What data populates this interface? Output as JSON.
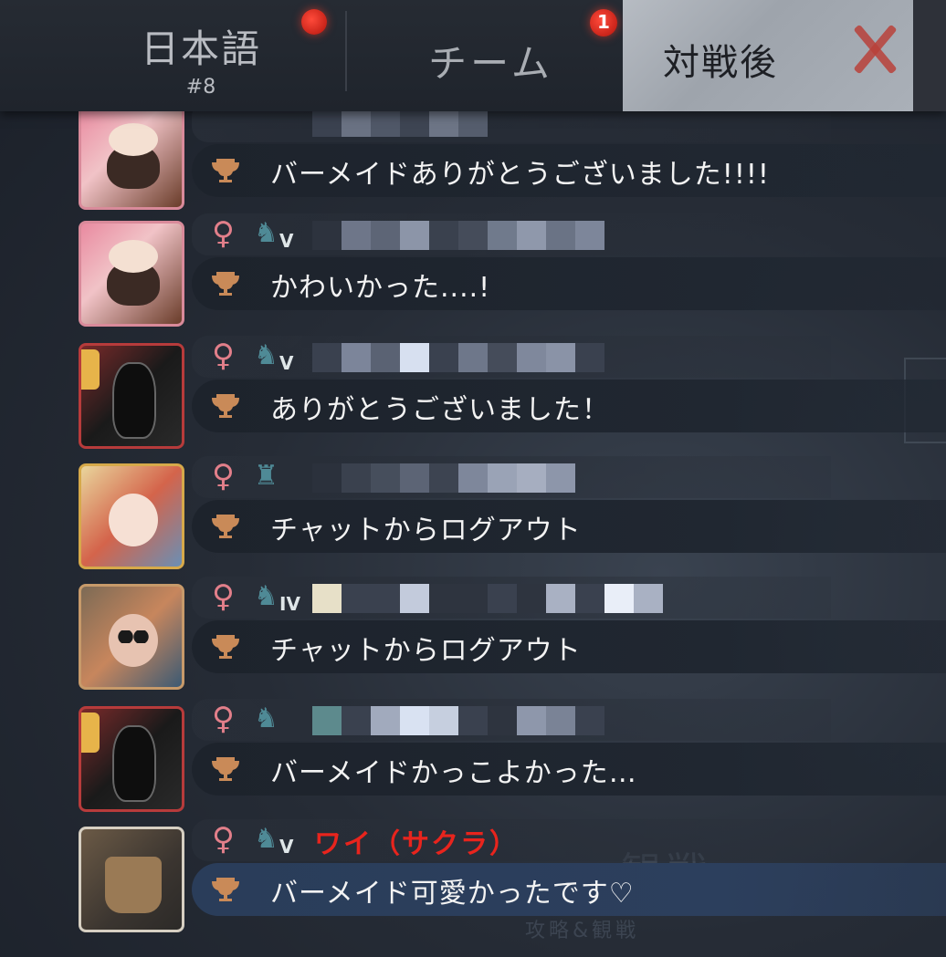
{
  "tabs": {
    "language": {
      "label": "日本語",
      "sub": "#8"
    },
    "team": {
      "label": "チーム",
      "badge": "1"
    },
    "after_match": {
      "label": "対戦後"
    }
  },
  "background": {
    "text_large": "観戦",
    "text_small": "攻略&観戦"
  },
  "messages": [
    {
      "avatar": "bartender",
      "gender": "",
      "rank": "",
      "name": "",
      "text": "バーメイドありがとうございました!!!!"
    },
    {
      "avatar": "bartender",
      "gender": "♀",
      "rank": "V",
      "name": "",
      "text": "かわいかった....!"
    },
    {
      "avatar": "dark",
      "gender": "♀",
      "rank": "V",
      "name": "",
      "text": "ありがとうございました！"
    },
    {
      "avatar": "girl",
      "gender": "♀",
      "rank": "",
      "name": "",
      "text": "チャットからログアウト"
    },
    {
      "avatar": "doll",
      "gender": "♀",
      "rank": "IV",
      "name": "",
      "text": "チャットからログアウト"
    },
    {
      "avatar": "dark",
      "gender": "♀",
      "rank": "",
      "name": "",
      "text": "バーメイドかっこよかった…"
    },
    {
      "avatar": "scarecrow",
      "gender": "♀",
      "rank": "V",
      "name": "ワイ（サクラ）",
      "text": "バーメイド可愛かったです♡",
      "is_self": true
    }
  ],
  "colors": {
    "accent_red": "#e8241d",
    "female_icon": "#e27f8a",
    "trophy": "#c98a58"
  },
  "icons": {
    "trophy": "trophy-icon",
    "close": "close-icon",
    "gender": "female-icon",
    "rank": "rank-badge-icon"
  }
}
